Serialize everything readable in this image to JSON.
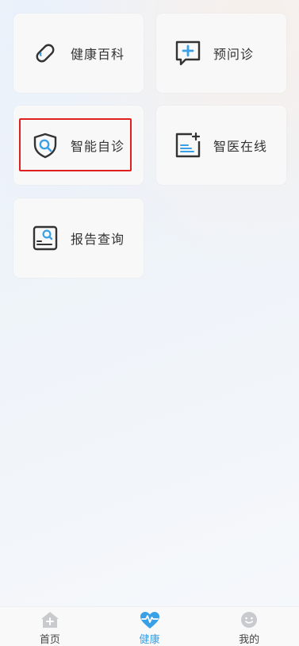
{
  "cards": [
    {
      "label": "健康百科",
      "icon": "pill-icon"
    },
    {
      "label": "预问诊",
      "icon": "chat-plus-icon"
    },
    {
      "label": "智能自诊",
      "icon": "shield-search-icon"
    },
    {
      "label": "智医在线",
      "icon": "document-plus-icon"
    },
    {
      "label": "报告查询",
      "icon": "report-search-icon"
    }
  ],
  "tabbar": {
    "items": [
      {
        "label": "首页",
        "icon": "home-icon"
      },
      {
        "label": "健康",
        "icon": "heart-pulse-icon",
        "active": true
      },
      {
        "label": "我的",
        "icon": "smiley-icon"
      }
    ]
  },
  "colors": {
    "accent": "#3aa0e6",
    "highlight": "#e02020",
    "icon_dark": "#333333"
  }
}
